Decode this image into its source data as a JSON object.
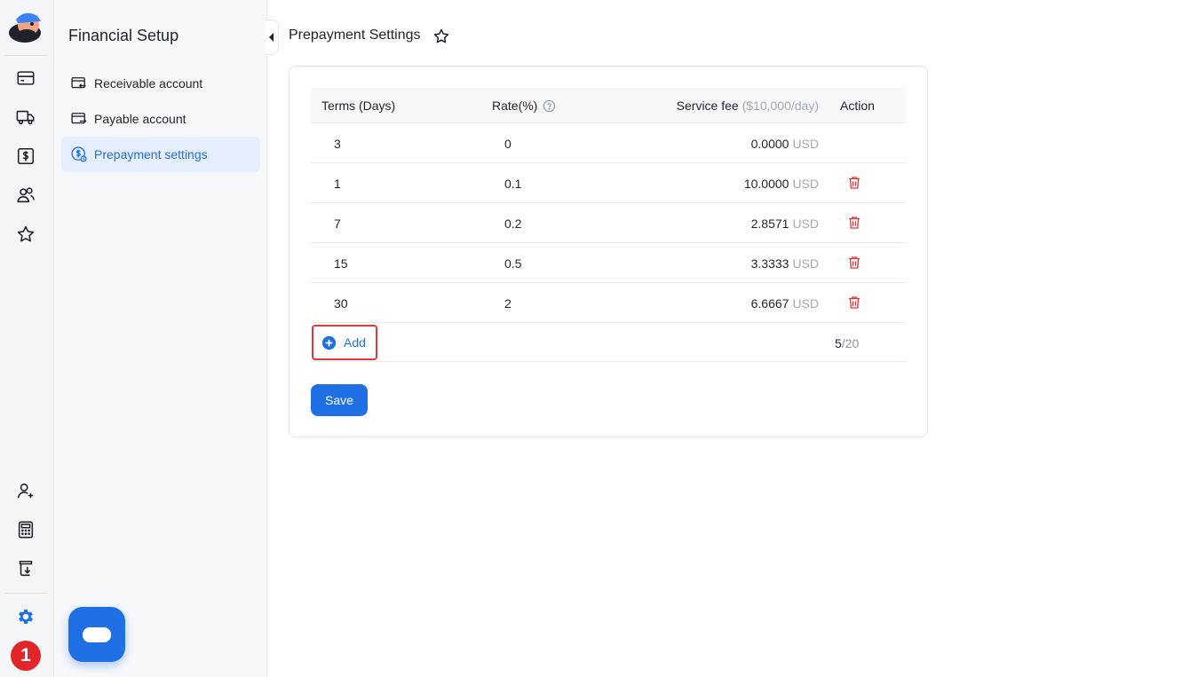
{
  "sidebar": {
    "title": "Financial Setup",
    "items": [
      {
        "label": "Receivable account",
        "icon": "receivable-card-icon"
      },
      {
        "label": "Payable account",
        "icon": "payable-card-icon"
      },
      {
        "label": "Prepayment settings",
        "icon": "prepayment-coin-icon",
        "active": true
      }
    ]
  },
  "rail": {
    "top_icons": [
      "card-icon",
      "truck-icon",
      "dollar-box-icon",
      "users-icon",
      "star-icon"
    ],
    "bottom_icons": [
      "add-user-icon",
      "calculator-icon",
      "download-icon",
      "settings-icon"
    ],
    "badge": "1"
  },
  "header": {
    "title": "Prepayment Settings"
  },
  "table": {
    "columns": {
      "terms": "Terms (Days)",
      "rate": "Rate(%)",
      "fee": "Service fee",
      "fee_suffix": "($10,000/day)",
      "action": "Action"
    },
    "rows": [
      {
        "terms": "3",
        "rate": "0",
        "fee": "0.0000",
        "unit": "USD",
        "deletable": false
      },
      {
        "terms": "1",
        "rate": "0.1",
        "fee": "10.0000",
        "unit": "USD",
        "deletable": true
      },
      {
        "terms": "7",
        "rate": "0.2",
        "fee": "2.8571",
        "unit": "USD",
        "deletable": true
      },
      {
        "terms": "15",
        "rate": "0.5",
        "fee": "3.3333",
        "unit": "USD",
        "deletable": true
      },
      {
        "terms": "30",
        "rate": "2",
        "fee": "6.6667",
        "unit": "USD",
        "deletable": true
      }
    ],
    "add_label": "Add",
    "count_current": "5",
    "count_max": "/20"
  },
  "save_label": "Save",
  "colors": {
    "accent": "#1f6fe5",
    "delete": "#e0393c",
    "highlight_border": "#e0393c"
  }
}
